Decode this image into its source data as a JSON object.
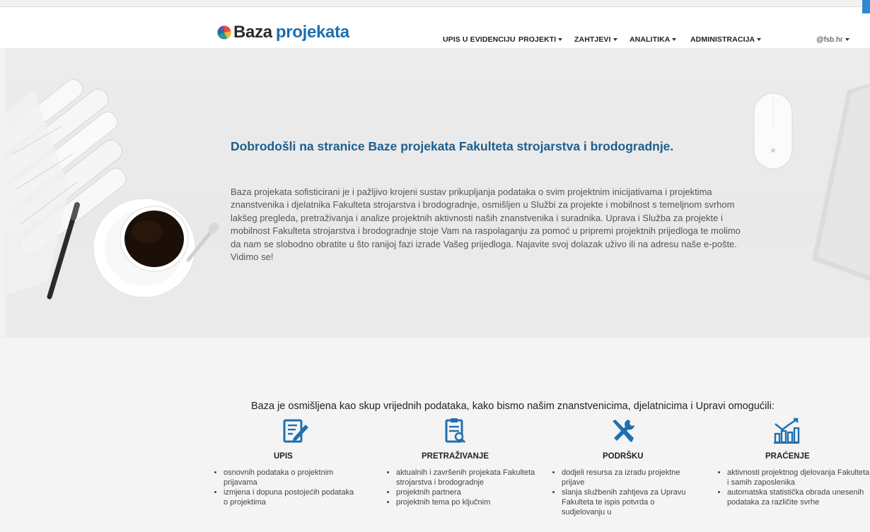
{
  "brand": {
    "name_part1": "Baza",
    "name_part2": "projekata"
  },
  "nav": {
    "items": [
      {
        "label": "UPIS U EVIDENCIJU",
        "dropdown": false
      },
      {
        "label": "PROJEKTI",
        "dropdown": true
      },
      {
        "label": "ZAHTJEVI",
        "dropdown": true
      },
      {
        "label": "ANALITIKA",
        "dropdown": true
      },
      {
        "label": "ADMINISTRACIJA",
        "dropdown": true
      }
    ],
    "user": "@fsb.hr"
  },
  "hero": {
    "title": "Dobrodošli na stranice Baze projekata Fakulteta strojarstva i brodogradnje.",
    "text": "Baza projekata sofisticirani je i pažljivo krojeni sustav prikupljanja podataka o svim projektnim inicijativama i projektima znanstvenika i djelatnika Fakulteta strojarstva i brodogradnje, osmišljen u Službi za projekte i mobilnost s temeljnom svrhom lakšeg pregleda, pretraživanja i analize projektnih aktivnosti naših znanstvenika i suradnika. Uprava i Služba za projekte i mobilnost Fakulteta strojarstva i brodogradnje stoje Vam na raspolaganju za pomoć u pripremi projektnih prijedloga te molimo da nam se slobodno obratite u što ranijoj fazi izrade Vašeg prijedloga. Najavite svoj dolazak uživo ili na adresu naše e-pošte. Vidimo se!"
  },
  "features": {
    "heading": "Baza je osmišljena kao skup vrijednih podataka, kako bismo našim znanstvenicima, djelatnicima i Upravi omogućili:",
    "accent_color": "#1f6fae",
    "items": [
      {
        "title": "UPIS",
        "icon": "edit-document-icon",
        "bullets": [
          "osnovnih podataka o projektnim prijavama",
          "izmjena i dopuna postojećih podataka o projektima"
        ]
      },
      {
        "title": "PRETRAŽIVANJE",
        "icon": "search-document-icon",
        "bullets": [
          "aktualnih i završenih projekata Fakulteta strojarstva i brodogradnje",
          "projektnih partnera",
          "projektnih tema po ključnim"
        ]
      },
      {
        "title": "PODRŠKU",
        "icon": "tools-icon",
        "bullets": [
          "dodjeli resursa za izradu projektne prijave",
          "slanja službenih zahtjeva za Upravu Fakulteta te ispis potvrda o sudjelovanju u"
        ]
      },
      {
        "title": "PRAĆENJE",
        "icon": "analytics-chart-icon",
        "bullets": [
          "aktivnosti projektnog djelovanja Fakulteta i samih zaposlenika",
          "automatska statistička obrada unesenih podataka za različite svrhe"
        ]
      }
    ]
  }
}
